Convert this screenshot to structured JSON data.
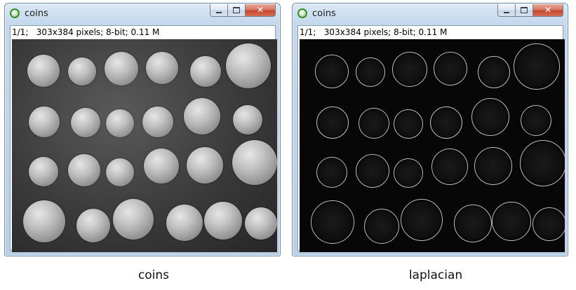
{
  "windows": [
    {
      "title": "coins",
      "info": "1/1;   303x384 pixels; 8-bit; 0.11 M",
      "image": "coins grayscale photo"
    },
    {
      "title": "coins",
      "info": "1/1;   303x384 pixels; 8-bit; 0.11 M",
      "image": "laplacian edge image"
    }
  ],
  "buttons": {
    "minimize": "—",
    "maximize": "□",
    "close": "✕"
  },
  "captions": {
    "left": "coins",
    "right": "laplacian"
  },
  "icons": {
    "app": "imagej-app-icon"
  }
}
